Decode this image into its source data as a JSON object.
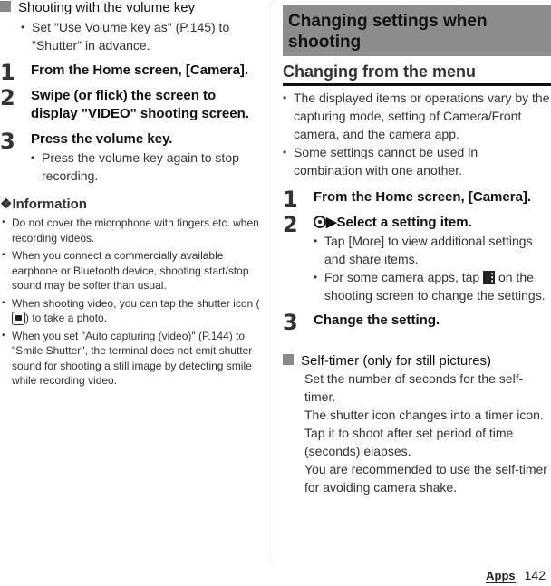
{
  "left": {
    "volume_heading": "Shooting with the volume key",
    "volume_note": "Set \"Use Volume key as\" (P.145) to \"Shutter\" in advance.",
    "steps": [
      {
        "num": "1",
        "title": "From the Home screen, [Camera]."
      },
      {
        "num": "2",
        "title": "Swipe (or flick) the screen to display \"VIDEO\" shooting screen."
      },
      {
        "num": "3",
        "title": "Press the volume key.",
        "note": "Press the volume key again to stop recording."
      }
    ],
    "info": {
      "title": "❖Information",
      "items": [
        "Do not cover the microphone with fingers etc. when recording videos.",
        "When you connect a commercially available earphone or Bluetooth device, shooting start/stop sound may be softer than usual.",
        {
          "before": "When shooting video, you can tap the shutter icon (",
          "icon": "camera-shutter-icon",
          "after": ") to take a photo."
        },
        "When you set \"Auto capturing (video)\" (P.144) to \"Smile Shutter\", the terminal does not emit shutter sound for shooting a still image by detecting smile while recording video."
      ]
    }
  },
  "right": {
    "banner": "Changing settings when shooting",
    "sub_heading": "Changing from the menu",
    "notes": [
      "The displayed items or operations vary by the capturing mode, setting of Camera/Front camera, and the camera app.",
      "Some settings cannot be used in combination with one another."
    ],
    "steps": [
      {
        "num": "1",
        "title": "From the Home screen, [Camera]."
      },
      {
        "num": "2",
        "icon": "settings-gear-icon",
        "title": "▶Select a setting item.",
        "notes": [
          "Tap [More] to view additional settings and share items.",
          {
            "before": "For some camera apps, tap ",
            "icon": "more-options-icon",
            "after": " on the shooting screen to change the settings."
          }
        ]
      },
      {
        "num": "3",
        "title": "Change the setting."
      }
    ],
    "self_timer": {
      "heading": "Self-timer (only for still pictures)",
      "lines": [
        "Set the number of seconds for the self-timer.",
        "The shutter icon changes into a timer icon. Tap it to shoot after set period of time (seconds) elapses.",
        "You are recommended to use the self-timer for avoiding camera shake."
      ]
    }
  },
  "footer": {
    "section": "Apps",
    "page": "142"
  }
}
